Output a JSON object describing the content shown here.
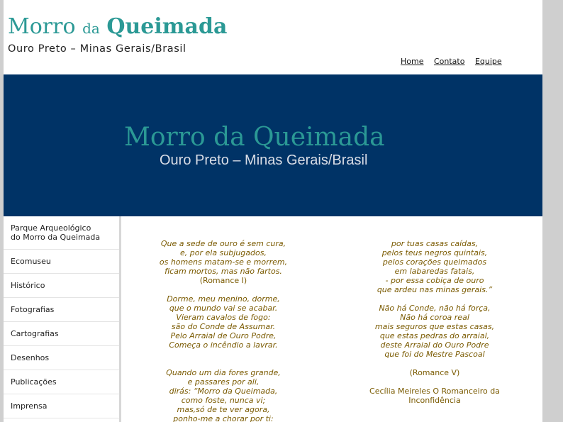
{
  "header": {
    "logo_title_main": "Morro",
    "logo_title_small": "da",
    "logo_title_bold": "Queimada",
    "logo_subtitle": "Ouro Preto – Minas Gerais/Brasil"
  },
  "topnav": [
    "Home",
    "Contato",
    "Equipe"
  ],
  "banner": {
    "title": "Morro da Queimada",
    "subtitle": "Ouro Preto – Minas Gerais/Brasil"
  },
  "sidebar": [
    "Parque Arqueológico\ndo Morro da Queimada",
    "Ecomuseu",
    "Histórico",
    "Fotografias",
    "Cartografias",
    "Desenhos",
    "Publicações",
    "Imprensa"
  ],
  "poem_left": [
    {
      "t": "Que a sede de ouro é sem cura,",
      "i": true
    },
    {
      "t": "e, por ela subjugados,",
      "i": true
    },
    {
      "t": "os homens matam-se e morrem,",
      "i": true
    },
    {
      "t": "ficam mortos, mas não fartos.",
      "i": true
    },
    {
      "t": "(Romance I)",
      "i": false
    },
    {
      "t": "",
      "i": false
    },
    {
      "t": "Dorme, meu menino, dorme,",
      "i": true
    },
    {
      "t": "que o mundo vai se acabar.",
      "i": true
    },
    {
      "t": "Vieram cavalos de fogo:",
      "i": true
    },
    {
      "t": "são do Conde de Assumar.",
      "i": true
    },
    {
      "t": "Pelo Arraial de Ouro Podre,",
      "i": true
    },
    {
      "t": "Começa o incêndio a lavrar.",
      "i": true
    },
    {
      "t": "",
      "i": false
    },
    {
      "t": "",
      "i": false
    },
    {
      "t": "Quando um dia fores grande,",
      "i": true
    },
    {
      "t": "e passares por ali,",
      "i": true
    },
    {
      "t": "dirás: “Morro da Queimada,",
      "i": true
    },
    {
      "t": "como foste, nunca vi;",
      "i": true
    },
    {
      "t": "mas,só de te ver agora,",
      "i": true
    },
    {
      "t": "ponho-me a chorar por ti:",
      "i": true
    }
  ],
  "poem_right": [
    {
      "t": "por tuas casas caídas,",
      "i": true
    },
    {
      "t": "pelos teus negros quintais,",
      "i": true
    },
    {
      "t": "pelos corações queimados",
      "i": true
    },
    {
      "t": "em labaredas fatais,",
      "i": true
    },
    {
      "t": "- por essa cobiça de ouro",
      "i": true
    },
    {
      "t": "que ardeu nas minas gerais.”",
      "i": true
    },
    {
      "t": "",
      "i": false
    },
    {
      "t": "Não há Conde, não há força,",
      "i": true
    },
    {
      "t": "Não há coroa real",
      "i": true
    },
    {
      "t": "mais seguros que estas casas,",
      "i": true
    },
    {
      "t": "que estas pedras do arraial,",
      "i": true
    },
    {
      "t": "deste Arraial do Ouro Podre",
      "i": true
    },
    {
      "t": "que foi do Mestre Pascoal",
      "i": true
    },
    {
      "t": "",
      "i": false
    },
    {
      "t": "(Romance V)",
      "i": false
    },
    {
      "t": "",
      "i": false
    },
    {
      "t": "Cecília Meireles O Romanceiro da",
      "i": false
    },
    {
      "t": "Inconfidência",
      "i": false
    }
  ]
}
